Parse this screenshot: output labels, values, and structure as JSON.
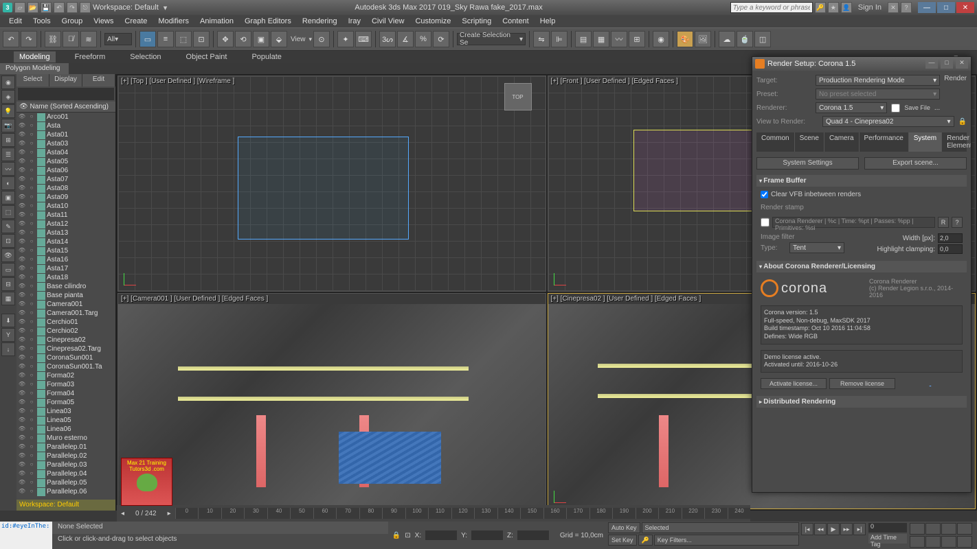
{
  "app": {
    "title_center": "Autodesk 3ds Max 2017   019_Sky Rawa fake_2017.max",
    "workspace_label": "Workspace: Default",
    "search_placeholder": "Type a keyword or phrase",
    "signin": "Sign In"
  },
  "menus": [
    "Edit",
    "Tools",
    "Group",
    "Views",
    "Create",
    "Modifiers",
    "Animation",
    "Graph Editors",
    "Rendering",
    "Iray",
    "Civil View",
    "Customize",
    "Scripting",
    "Content",
    "Help"
  ],
  "ribbon": {
    "tabs": [
      "Modeling",
      "Freeform",
      "Selection",
      "Object Paint",
      "Populate"
    ],
    "active": 0,
    "panel": "Polygon Modeling"
  },
  "selection_filter": "All",
  "view_label": "View",
  "create_selection": "Create Selection Se",
  "scene_explorer": {
    "tabs": [
      "Select",
      "Display",
      "Edit"
    ],
    "header": "Name (Sorted Ascending)",
    "workspace": "Workspace: Default",
    "items": [
      "Arco01",
      "Asta",
      "Asta01",
      "Asta03",
      "Asta04",
      "Asta05",
      "Asta06",
      "Asta07",
      "Asta08",
      "Asta09",
      "Asta10",
      "Asta11",
      "Asta12",
      "Asta13",
      "Asta14",
      "Asta15",
      "Asta16",
      "Asta17",
      "Asta18",
      "Base cilindro",
      "Base pianta",
      "Camera001",
      "Camera001.Targ",
      "Cerchio01",
      "Cerchio02",
      "Cinepresa02",
      "Cinepresa02.Targ",
      "CoronaSun001",
      "CoronaSun001.Ta",
      "Forma02",
      "Forma03",
      "Forma04",
      "Forma05",
      "Linea03",
      "Linea05",
      "Linea06",
      "Muro esterno",
      "Parallelep.01",
      "Parallelep.02",
      "Parallelep.03",
      "Parallelep.04",
      "Parallelep.05",
      "Parallelep.06"
    ]
  },
  "viewports": {
    "top": "[+] [Top ] [User Defined ] [Wireframe ]",
    "front": "[+] [Front ] [User Defined ] [Edged Faces ]",
    "cam1": "[+] [Camera001 ] [User Defined ] [Edged Faces ]",
    "cam2": "[+] [Cinepresa02 ] [User Defined ] [Edged Faces ]",
    "viewcube": "TOP"
  },
  "timeline": {
    "frame": "0 / 242",
    "ticks": [
      "0",
      "10",
      "20",
      "30",
      "40",
      "50",
      "60",
      "70",
      "80",
      "90",
      "100",
      "110",
      "120",
      "130",
      "140",
      "150",
      "160",
      "170",
      "180",
      "190",
      "200",
      "210",
      "220",
      "230",
      "240"
    ]
  },
  "status": {
    "script_id": "id:#eyeInThe:",
    "selection": "None Selected",
    "prompt": "Click or click-and-drag to select objects",
    "x": "X:",
    "y": "Y:",
    "z": "Z:",
    "grid": "Grid = 10,0cm",
    "add_time_tag": "Add Time Tag",
    "auto_key": "Auto Key",
    "set_key": "Set Key",
    "selected": "Selected",
    "key_filters": "Key Filters..."
  },
  "render": {
    "title": "Render Setup: Corona 1.5",
    "target_lbl": "Target:",
    "target": "Production Rendering Mode",
    "preset_lbl": "Preset:",
    "preset": "No preset selected",
    "renderer_lbl": "Renderer:",
    "renderer": "Corona 1.5",
    "view_lbl": "View to Render:",
    "view": "Quad 4 - Cinepresa02",
    "render_btn": "Render",
    "save_file": "Save File",
    "tabs": [
      "Common",
      "Scene",
      "Camera",
      "Performance",
      "System",
      "Render Elements"
    ],
    "active_tab": 4,
    "sys_settings": "System Settings",
    "export_scene": "Export scene...",
    "fb_header": "Frame Buffer",
    "clear_vfb": "Clear VFB inbetween renders",
    "render_stamp": "Render stamp",
    "stamp_text": "Corona Renderer | %c | Time: %pt | Passes: %pp | Primitives: %si",
    "image_filter": "Image filter",
    "type_lbl": "Type:",
    "type": "Tent",
    "width_lbl": "Width [px]:",
    "width": "2,0",
    "hclamp_lbl": "Highlight clamping:",
    "hclamp": "0,0",
    "about_header": "About Corona Renderer/Licensing",
    "corona_name": "corona",
    "corona_right": "Corona Renderer\n(c) Render Legion s.r.o., 2014-2016",
    "version_box": "Corona version: 1.5\nFull-speed, Non-debug, MaxSDK 2017\nBuild timestamp: Oct 10 2016 11:04:58\nDefines: Wide RGB",
    "license_box": "Demo license active.\nActivated until: 2016-10-26",
    "activate": "Activate license...",
    "remove": "Remove license",
    "search_link": "",
    "dist_header": "Distributed Rendering"
  },
  "watermark": {
    "l1": "Max 21 Training",
    "l2": "Tutors3d .com"
  }
}
